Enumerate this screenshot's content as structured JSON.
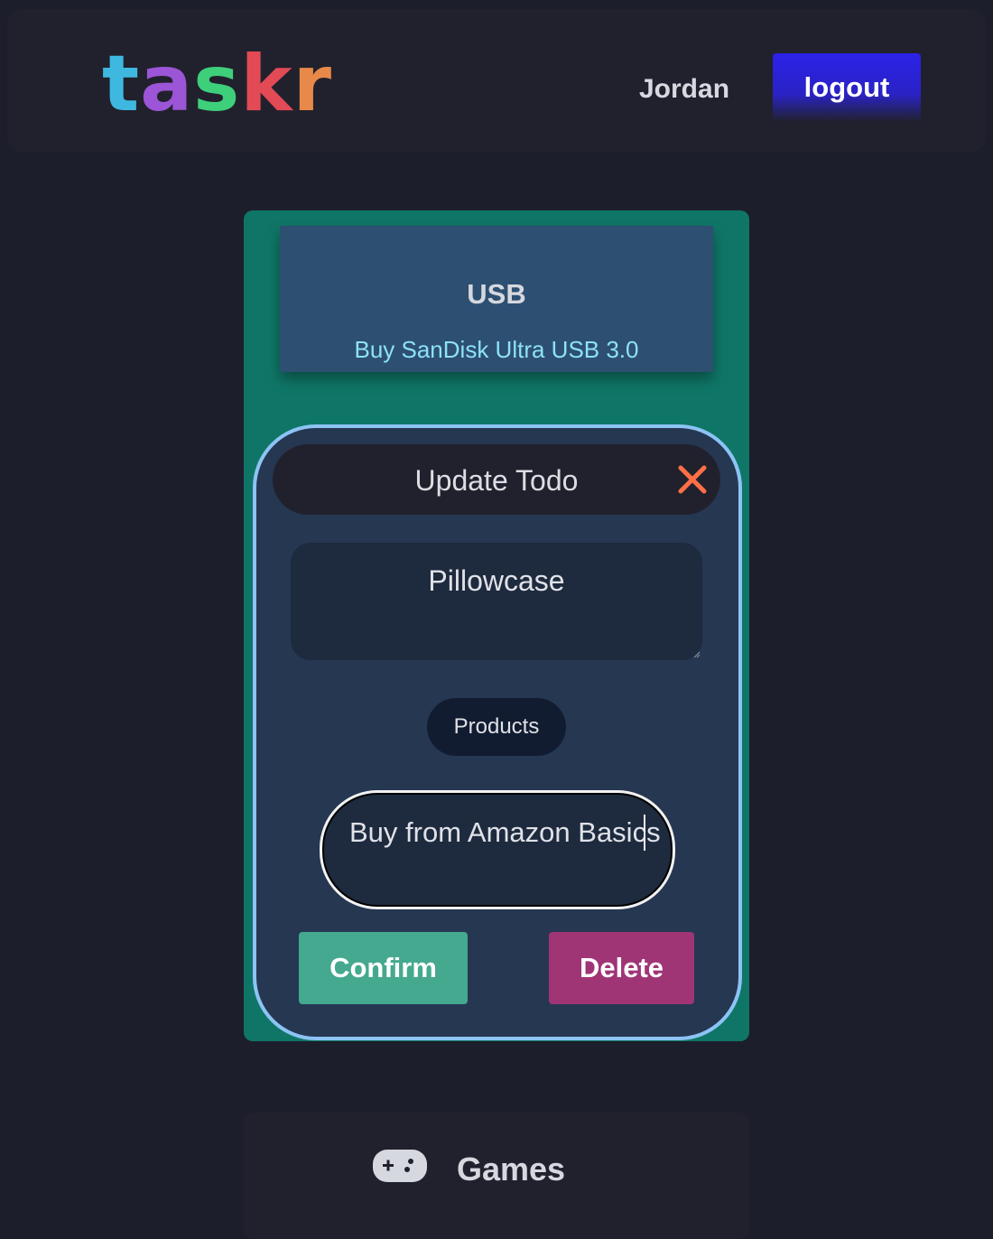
{
  "header": {
    "logo_letters": [
      {
        "char": "t",
        "color": "#3fb8e0"
      },
      {
        "char": "a",
        "color": "#9b55d6"
      },
      {
        "char": "s",
        "color": "#3ecf7a"
      },
      {
        "char": "k",
        "color": "#e24a55"
      },
      {
        "char": "r",
        "color": "#e8894a"
      }
    ],
    "username": "Jordan",
    "logout_label": "logout"
  },
  "todo": {
    "title": "USB",
    "description": "Buy SanDisk Ultra USB 3.0"
  },
  "modal": {
    "title": "Update Todo",
    "close_icon": "close-icon",
    "title_field_value": "Pillowcase",
    "category": "Products",
    "description_value": "Buy from Amazon Basics",
    "confirm_label": "Confirm",
    "delete_label": "Delete"
  },
  "games": {
    "icon": "gamepad-icon",
    "label": "Games"
  },
  "colors": {
    "page_bg": "#1d1e2b",
    "card_bg": "#0f7667",
    "modal_border": "#8dc3f5",
    "close_icon": "#ff6f47",
    "confirm": "#44a98f",
    "delete": "#a03576",
    "logout": "#2b22e8"
  }
}
